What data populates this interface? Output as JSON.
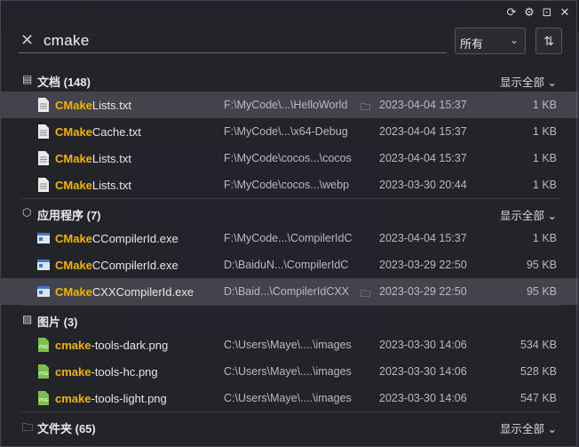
{
  "window": {
    "icons": [
      "refresh-icon",
      "gear-icon",
      "pin-icon",
      "close-icon"
    ]
  },
  "search": {
    "query": "cmake",
    "filter": "所有"
  },
  "sections": {
    "documents": {
      "title": "文档 (148)",
      "more": "显示全部",
      "rows": [
        {
          "match": "CMake",
          "rest": "Lists.txt",
          "path": "F:\\MyCode\\...\\HelloWorld",
          "date": "2023-04-04 15:37",
          "size": "1 KB"
        },
        {
          "match": "CMake",
          "rest": "Cache.txt",
          "path": "F:\\MyCode\\...\\x64-Debug",
          "date": "2023-04-04 15:37",
          "size": "1 KB"
        },
        {
          "match": "CMake",
          "rest": "Lists.txt",
          "path": "F:\\MyCode\\cocos...\\cocos",
          "date": "2023-04-04 15:37",
          "size": "1 KB"
        },
        {
          "match": "CMake",
          "rest": "Lists.txt",
          "path": "F:\\MyCode\\cocos...\\webp",
          "date": "2023-03-30 20:44",
          "size": "1 KB"
        }
      ]
    },
    "apps": {
      "title": "应用程序 (7)",
      "more": "显示全部",
      "rows": [
        {
          "match": "CMake",
          "rest": "CCompilerId.exe",
          "path": "F:\\MyCode...\\CompilerIdC",
          "date": "2023-04-04 15:37",
          "size": "1 KB"
        },
        {
          "match": "CMake",
          "rest": "CCompilerId.exe",
          "path": "D:\\BaiduN...\\CompilerIdC",
          "date": "2023-03-29 22:50",
          "size": "95 KB"
        },
        {
          "match": "CMake",
          "rest": "CXXCompilerId.exe",
          "path": "D:\\Baid...\\CompilerIdCXX",
          "date": "2023-03-29 22:50",
          "size": "95 KB"
        }
      ]
    },
    "images": {
      "title": "图片 (3)",
      "rows": [
        {
          "match": "cmake",
          "rest": "-tools-dark.png",
          "path": "C:\\Users\\Maye\\....\\images",
          "date": "2023-03-30 14:06",
          "size": "534 KB"
        },
        {
          "match": "cmake",
          "rest": "-tools-hc.png",
          "path": "C:\\Users\\Maye\\....\\images",
          "date": "2023-03-30 14:06",
          "size": "528 KB"
        },
        {
          "match": "cmake",
          "rest": "-tools-light.png",
          "path": "C:\\Users\\Maye\\....\\images",
          "date": "2023-03-30 14:06",
          "size": "547 KB"
        }
      ]
    },
    "folders": {
      "title": "文件夹 (65)",
      "more": "显示全部"
    }
  },
  "colors": {
    "highlight": "#f0b400",
    "panel_bg": "#22232a",
    "selected_row": "#5a5a62"
  }
}
